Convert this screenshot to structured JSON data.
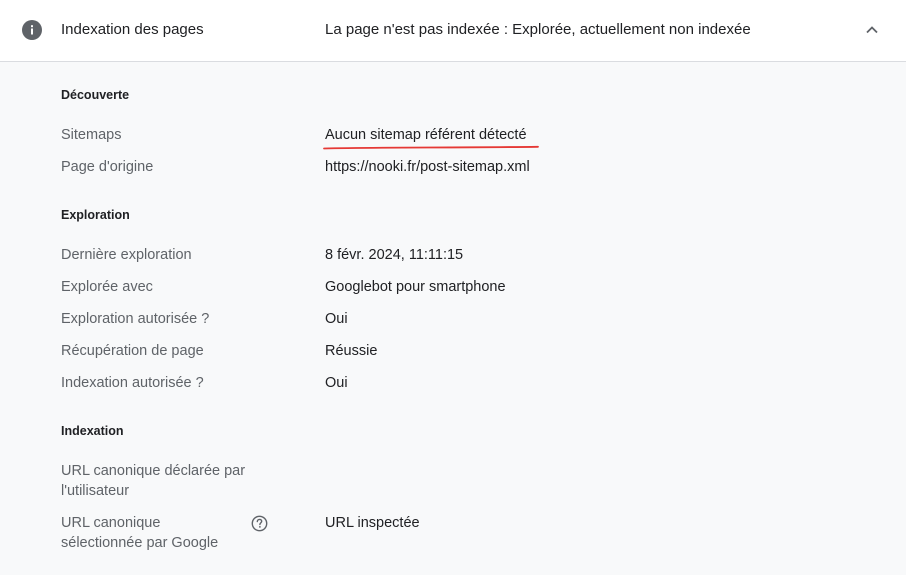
{
  "header": {
    "icon": "info-icon",
    "title": "Indexation des pages",
    "status": "La page n'est pas indexée : Explorée, actuellement non indexée",
    "toggle_icon": "chevron-up-icon"
  },
  "sections": {
    "discovery": {
      "title": "Découverte",
      "rows": [
        {
          "label": "Sitemaps",
          "value": "Aucun sitemap référent détecté"
        },
        {
          "label": "Page d'origine",
          "value": "https://nooki.fr/post-sitemap.xml"
        }
      ]
    },
    "crawl": {
      "title": "Exploration",
      "rows": [
        {
          "label": "Dernière exploration",
          "value": "8 févr. 2024, 11:11:15"
        },
        {
          "label": "Explorée avec",
          "value": "Googlebot pour smartphone"
        },
        {
          "label": "Exploration autorisée ?",
          "value": "Oui"
        },
        {
          "label": "Récupération de page",
          "value": "Réussie"
        },
        {
          "label": "Indexation autorisée ?",
          "value": "Oui"
        }
      ]
    },
    "indexing": {
      "title": "Indexation",
      "rows": [
        {
          "label": "URL canonique déclarée par l'utilisateur",
          "value": ""
        },
        {
          "label": "URL canonique sélectionnée par Google",
          "value": "URL inspectée",
          "help_icon": "help-icon"
        }
      ]
    }
  },
  "colors": {
    "annotation_underline": "#e53935",
    "icon_gray": "#5f6368",
    "label_gray": "#5f6368"
  }
}
